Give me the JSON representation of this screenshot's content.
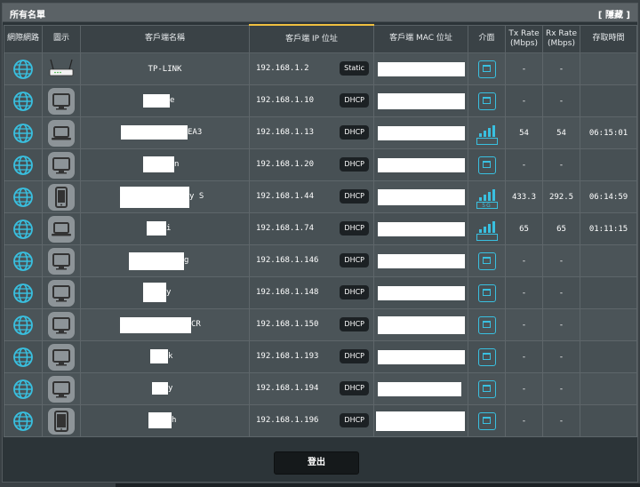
{
  "title": "所有名單",
  "hide_label": "[ 隱藏 ]",
  "columns": [
    "網際網路",
    "圖示",
    "客戶端名稱",
    "客戶端 IP 位址",
    "客戶端 MAC 位址",
    "介面",
    "Tx Rate (Mbps)",
    "Rx Rate (Mbps)",
    "存取時間"
  ],
  "clients": [
    {
      "icon": "router-icon",
      "name": "TP-LINK",
      "ip": "192.168.1.2",
      "ip_type": "Static",
      "interface": "ethernet",
      "tx": "-",
      "rx": "-",
      "access_time": ""
    },
    {
      "icon": "desktop-icon",
      "name": "e",
      "ip": "192.168.1.10",
      "ip_type": "DHCP",
      "interface": "ethernet",
      "tx": "-",
      "rx": "-",
      "access_time": ""
    },
    {
      "icon": "laptop-icon",
      "name": "EA3",
      "ip": "192.168.1.13",
      "ip_type": "DHCP",
      "interface": "wifi-2.4",
      "tx": "54",
      "rx": "54",
      "access_time": "06:15:01"
    },
    {
      "icon": "desktop-icon",
      "name": "n",
      "ip": "192.168.1.20",
      "ip_type": "DHCP",
      "interface": "ethernet",
      "tx": "-",
      "rx": "-",
      "access_time": ""
    },
    {
      "icon": "phone-icon",
      "name": "y S",
      "ip": "192.168.1.44",
      "ip_type": "DHCP",
      "interface": "wifi-5",
      "tx": "433.3",
      "rx": "292.5",
      "access_time": "06:14:59"
    },
    {
      "icon": "laptop-icon",
      "name": "i",
      "ip": "192.168.1.74",
      "ip_type": "DHCP",
      "interface": "wifi-2.4",
      "tx": "65",
      "rx": "65",
      "access_time": "01:11:15"
    },
    {
      "icon": "desktop-icon",
      "name": "g",
      "ip": "192.168.1.146",
      "ip_type": "DHCP",
      "interface": "ethernet",
      "tx": "-",
      "rx": "-",
      "access_time": ""
    },
    {
      "icon": "desktop-icon",
      "name": "y",
      "ip": "192.168.1.148",
      "ip_type": "DHCP",
      "interface": "ethernet",
      "tx": "-",
      "rx": "-",
      "access_time": ""
    },
    {
      "icon": "desktop-icon",
      "name": "CR",
      "ip": "192.168.1.150",
      "ip_type": "DHCP",
      "interface": "ethernet",
      "tx": "-",
      "rx": "-",
      "access_time": ""
    },
    {
      "icon": "desktop-icon",
      "name": "k",
      "ip": "192.168.1.193",
      "ip_type": "DHCP",
      "interface": "ethernet",
      "tx": "-",
      "rx": "-",
      "access_time": ""
    },
    {
      "icon": "desktop-icon",
      "name": "y",
      "ip": "192.168.1.194",
      "ip_type": "DHCP",
      "interface": "ethernet",
      "tx": "-",
      "rx": "-",
      "access_time": ""
    },
    {
      "icon": "tablet-icon",
      "name": "h",
      "ip": "192.168.1.196",
      "ip_type": "DHCP",
      "interface": "ethernet",
      "tx": "-",
      "rx": "-",
      "access_time": ""
    }
  ],
  "band_labels": {
    "wifi-2.4": "2.4",
    "wifi-5": "5G"
  },
  "logout_label": "登出",
  "colors": {
    "accent": "#39c0e0",
    "background": "#2c3438",
    "row": "#4b5458"
  }
}
